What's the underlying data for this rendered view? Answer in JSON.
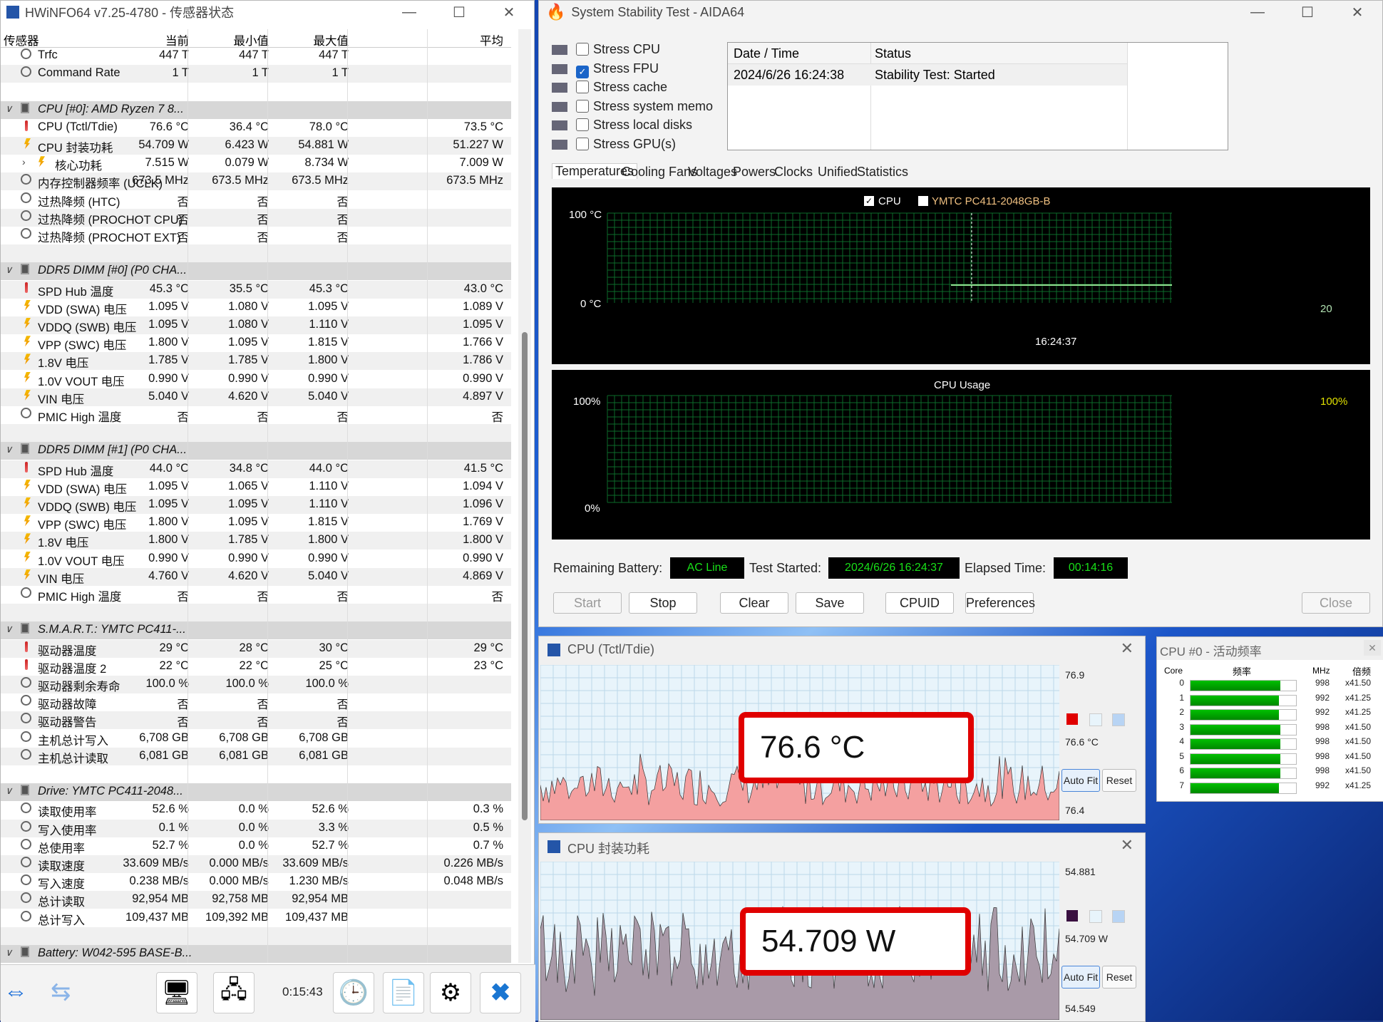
{
  "hwinfo": {
    "title": "HWiNFO64 v7.25-4780 - 传感器状态",
    "columns": [
      "传感器",
      "当前",
      "最小值",
      "最大值",
      "平均"
    ],
    "rows": [
      {
        "type": "sensor",
        "icon": "clock",
        "name": "Trfc",
        "cur": "447 T",
        "min": "447 T",
        "max": "447 T",
        "avg": ""
      },
      {
        "type": "sensor",
        "icon": "clock",
        "name": "Command Rate",
        "cur": "1 T",
        "min": "1 T",
        "max": "1 T",
        "avg": ""
      },
      {
        "type": "blank"
      },
      {
        "type": "group",
        "name": "CPU [#0]: AMD Ryzen 7 8..."
      },
      {
        "type": "sensor",
        "icon": "therm",
        "name": "CPU (Tctl/Tdie)",
        "cur": "76.6 °C",
        "min": "36.4 °C",
        "max": "78.0 °C",
        "avg": "73.5 °C"
      },
      {
        "type": "sensor",
        "icon": "bolt",
        "name": "CPU 封装功耗",
        "cur": "54.709 W",
        "min": "6.423 W",
        "max": "54.881 W",
        "avg": "51.227 W"
      },
      {
        "type": "sensor",
        "icon": "bolt",
        "name": "核心功耗",
        "cur": "7.515 W",
        "min": "0.079 W",
        "max": "8.734 W",
        "avg": "7.009 W",
        "expandable": true
      },
      {
        "type": "sensor",
        "icon": "clock",
        "name": "内存控制器频率 (UCLK)",
        "cur": "673.5 MHz",
        "min": "673.5 MHz",
        "max": "673.5 MHz",
        "avg": "673.5 MHz"
      },
      {
        "type": "sensor",
        "icon": "clock",
        "name": "过热降频 (HTC)",
        "cur": "否",
        "min": "否",
        "max": "否",
        "avg": ""
      },
      {
        "type": "sensor",
        "icon": "clock",
        "name": "过热降频 (PROCHOT CPU)",
        "cur": "否",
        "min": "否",
        "max": "否",
        "avg": ""
      },
      {
        "type": "sensor",
        "icon": "clock",
        "name": "过热降频 (PROCHOT EXT)",
        "cur": "否",
        "min": "否",
        "max": "否",
        "avg": ""
      },
      {
        "type": "blank"
      },
      {
        "type": "group",
        "name": "DDR5 DIMM [#0] (P0 CHA..."
      },
      {
        "type": "sensor",
        "icon": "therm",
        "name": "SPD Hub 温度",
        "cur": "45.3 °C",
        "min": "35.5 °C",
        "max": "45.3 °C",
        "avg": "43.0 °C"
      },
      {
        "type": "sensor",
        "icon": "bolt",
        "name": "VDD (SWA) 电压",
        "cur": "1.095 V",
        "min": "1.080 V",
        "max": "1.095 V",
        "avg": "1.089 V"
      },
      {
        "type": "sensor",
        "icon": "bolt",
        "name": "VDDQ (SWB) 电压",
        "cur": "1.095 V",
        "min": "1.080 V",
        "max": "1.110 V",
        "avg": "1.095 V"
      },
      {
        "type": "sensor",
        "icon": "bolt",
        "name": "VPP (SWC) 电压",
        "cur": "1.800 V",
        "min": "1.095 V",
        "max": "1.815 V",
        "avg": "1.766 V"
      },
      {
        "type": "sensor",
        "icon": "bolt",
        "name": "1.8V 电压",
        "cur": "1.785 V",
        "min": "1.785 V",
        "max": "1.800 V",
        "avg": "1.786 V"
      },
      {
        "type": "sensor",
        "icon": "bolt",
        "name": "1.0V VOUT 电压",
        "cur": "0.990 V",
        "min": "0.990 V",
        "max": "0.990 V",
        "avg": "0.990 V"
      },
      {
        "type": "sensor",
        "icon": "bolt",
        "name": "VIN 电压",
        "cur": "5.040 V",
        "min": "4.620 V",
        "max": "5.040 V",
        "avg": "4.897 V"
      },
      {
        "type": "sensor",
        "icon": "clock",
        "name": "PMIC High 温度",
        "cur": "否",
        "min": "否",
        "max": "否",
        "avg": "否"
      },
      {
        "type": "blank"
      },
      {
        "type": "group",
        "name": "DDR5 DIMM [#1] (P0 CHA..."
      },
      {
        "type": "sensor",
        "icon": "therm",
        "name": "SPD Hub 温度",
        "cur": "44.0 °C",
        "min": "34.8 °C",
        "max": "44.0 °C",
        "avg": "41.5 °C"
      },
      {
        "type": "sensor",
        "icon": "bolt",
        "name": "VDD (SWA) 电压",
        "cur": "1.095 V",
        "min": "1.065 V",
        "max": "1.110 V",
        "avg": "1.094 V"
      },
      {
        "type": "sensor",
        "icon": "bolt",
        "name": "VDDQ (SWB) 电压",
        "cur": "1.095 V",
        "min": "1.095 V",
        "max": "1.110 V",
        "avg": "1.096 V"
      },
      {
        "type": "sensor",
        "icon": "bolt",
        "name": "VPP (SWC) 电压",
        "cur": "1.800 V",
        "min": "1.095 V",
        "max": "1.815 V",
        "avg": "1.769 V"
      },
      {
        "type": "sensor",
        "icon": "bolt",
        "name": "1.8V 电压",
        "cur": "1.800 V",
        "min": "1.785 V",
        "max": "1.800 V",
        "avg": "1.800 V"
      },
      {
        "type": "sensor",
        "icon": "bolt",
        "name": "1.0V VOUT 电压",
        "cur": "0.990 V",
        "min": "0.990 V",
        "max": "0.990 V",
        "avg": "0.990 V"
      },
      {
        "type": "sensor",
        "icon": "bolt",
        "name": "VIN 电压",
        "cur": "4.760 V",
        "min": "4.620 V",
        "max": "5.040 V",
        "avg": "4.869 V"
      },
      {
        "type": "sensor",
        "icon": "clock",
        "name": "PMIC High 温度",
        "cur": "否",
        "min": "否",
        "max": "否",
        "avg": "否"
      },
      {
        "type": "blank"
      },
      {
        "type": "group",
        "name": "S.M.A.R.T.: YMTC PC411-..."
      },
      {
        "type": "sensor",
        "icon": "therm",
        "name": "驱动器温度",
        "cur": "29 °C",
        "min": "28 °C",
        "max": "30 °C",
        "avg": "29 °C"
      },
      {
        "type": "sensor",
        "icon": "therm",
        "name": "驱动器温度 2",
        "cur": "22 °C",
        "min": "22 °C",
        "max": "25 °C",
        "avg": "23 °C"
      },
      {
        "type": "sensor",
        "icon": "clock",
        "name": "驱动器剩余寿命",
        "cur": "100.0 %",
        "min": "100.0 %",
        "max": "100.0 %",
        "avg": ""
      },
      {
        "type": "sensor",
        "icon": "clock",
        "name": "驱动器故障",
        "cur": "否",
        "min": "否",
        "max": "否",
        "avg": ""
      },
      {
        "type": "sensor",
        "icon": "clock",
        "name": "驱动器警告",
        "cur": "否",
        "min": "否",
        "max": "否",
        "avg": ""
      },
      {
        "type": "sensor",
        "icon": "clock",
        "name": "主机总计写入",
        "cur": "6,708 GB",
        "min": "6,708 GB",
        "max": "6,708 GB",
        "avg": ""
      },
      {
        "type": "sensor",
        "icon": "clock",
        "name": "主机总计读取",
        "cur": "6,081 GB",
        "min": "6,081 GB",
        "max": "6,081 GB",
        "avg": ""
      },
      {
        "type": "blank"
      },
      {
        "type": "group",
        "name": "Drive: YMTC PC411-2048..."
      },
      {
        "type": "sensor",
        "icon": "clock",
        "name": "读取使用率",
        "cur": "52.6 %",
        "min": "0.0 %",
        "max": "52.6 %",
        "avg": "0.3 %"
      },
      {
        "type": "sensor",
        "icon": "clock",
        "name": "写入使用率",
        "cur": "0.1 %",
        "min": "0.0 %",
        "max": "3.3 %",
        "avg": "0.5 %"
      },
      {
        "type": "sensor",
        "icon": "clock",
        "name": "总使用率",
        "cur": "52.7 %",
        "min": "0.0 %",
        "max": "52.7 %",
        "avg": "0.7 %"
      },
      {
        "type": "sensor",
        "icon": "clock",
        "name": "读取速度",
        "cur": "33.609 MB/s",
        "min": "0.000 MB/s",
        "max": "33.609 MB/s",
        "avg": "0.226 MB/s"
      },
      {
        "type": "sensor",
        "icon": "clock",
        "name": "写入速度",
        "cur": "0.238 MB/s",
        "min": "0.000 MB/s",
        "max": "1.230 MB/s",
        "avg": "0.048 MB/s"
      },
      {
        "type": "sensor",
        "icon": "clock",
        "name": "总计读取",
        "cur": "92,954 MB",
        "min": "92,758 MB",
        "max": "92,954 MB",
        "avg": ""
      },
      {
        "type": "sensor",
        "icon": "clock",
        "name": "总计写入",
        "cur": "109,437 MB",
        "min": "109,392 MB",
        "max": "109,437 MB",
        "avg": ""
      },
      {
        "type": "blank"
      },
      {
        "type": "group",
        "name": "Battery: W042-595 BASE-B..."
      }
    ],
    "elapsed": "0:15:43"
  },
  "aida": {
    "title": "System Stability Test - AIDA64",
    "stress": [
      {
        "label": "Stress CPU",
        "checked": false
      },
      {
        "label": "Stress FPU",
        "checked": true
      },
      {
        "label": "Stress cache",
        "checked": false
      },
      {
        "label": "Stress system memory",
        "checked": false
      },
      {
        "label": "Stress local disks",
        "checked": false
      },
      {
        "label": "Stress GPU(s)",
        "checked": false
      }
    ],
    "status_headers": {
      "date": "Date / Time",
      "status": "Status"
    },
    "status_row": {
      "date": "2024/6/26 16:24:38",
      "status": "Stability Test: Started"
    },
    "tabs": [
      "Temperatures",
      "Cooling Fans",
      "Voltages",
      "Powers",
      "Clocks",
      "Unified",
      "Statistics"
    ],
    "temp_graph": {
      "legend_cpu": "CPU",
      "legend_disk": "YMTC PC411-2048GB-B",
      "y_top": "100 °C",
      "y_bottom": "0 °C",
      "time": "16:24:37",
      "right_val": "20"
    },
    "usage_graph": {
      "title": "CPU Usage",
      "y_top": "100%",
      "y_bottom": "0%",
      "right_val": "100%"
    },
    "info": {
      "battery_label": "Remaining Battery:",
      "battery_val": "AC Line",
      "started_label": "Test Started:",
      "started_val": "2024/6/26 16:24:37",
      "elapsed_label": "Elapsed Time:",
      "elapsed_val": "00:14:16"
    },
    "buttons": {
      "start": "Start",
      "stop": "Stop",
      "clear": "Clear",
      "save": "Save",
      "cpuid": "CPUID",
      "prefs": "Preferences",
      "close": "Close"
    }
  },
  "temp_window": {
    "title": "CPU (Tctl/Tdie)",
    "max": "76.9",
    "cur": "76.6 °C",
    "min": "76.4",
    "big": "76.6 °C",
    "autofit": "Auto Fit",
    "reset": "Reset",
    "color": "#f4a0a0"
  },
  "power_window": {
    "title": "CPU 封装功耗",
    "max": "54.881",
    "cur": "54.709 W",
    "min": "54.549",
    "big": "54.709 W",
    "autofit": "Auto Fit",
    "reset": "Reset",
    "color": "#a99aa8"
  },
  "freq_window": {
    "title": "CPU #0 - 活动频率",
    "headers": {
      "core": "Core",
      "freq": "频率",
      "mhz": "MHz",
      "mult": "倍频"
    },
    "cores": [
      {
        "n": "0",
        "fill": 0.85,
        "mhz": "998",
        "mult": "x41.50"
      },
      {
        "n": "1",
        "fill": 0.84,
        "mhz": "992",
        "mult": "x41.25"
      },
      {
        "n": "2",
        "fill": 0.84,
        "mhz": "992",
        "mult": "x41.25"
      },
      {
        "n": "3",
        "fill": 0.85,
        "mhz": "998",
        "mult": "x41.50"
      },
      {
        "n": "4",
        "fill": 0.85,
        "mhz": "998",
        "mult": "x41.50"
      },
      {
        "n": "5",
        "fill": 0.85,
        "mhz": "998",
        "mult": "x41.50"
      },
      {
        "n": "6",
        "fill": 0.85,
        "mhz": "998",
        "mult": "x41.50"
      },
      {
        "n": "7",
        "fill": 0.84,
        "mhz": "992",
        "mult": "x41.25"
      }
    ]
  }
}
